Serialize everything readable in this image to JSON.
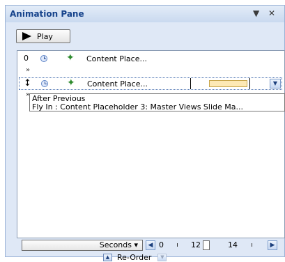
{
  "pane": {
    "title": "Animation Pane",
    "dropdown_icon": "▼",
    "close_icon": "✕"
  },
  "toolbar": {
    "play_label": "Play"
  },
  "animations": [
    {
      "index": "0",
      "label": "Content Place..."
    },
    {
      "index": "",
      "label": "Content Place..."
    }
  ],
  "tooltip": {
    "line1": "After Previous",
    "line2": "Fly In : Content Placeholder 3: Master Views Slide Ma..."
  },
  "timeline": {
    "seconds_label": "Seconds ▾",
    "scale": [
      "0",
      "12",
      "14"
    ]
  },
  "reorder": {
    "label": "Re-Order"
  },
  "colors": {
    "pane_bg": "#dfe8f6",
    "title_text": "#15428b",
    "timeline_bar": "#fde9b5"
  }
}
